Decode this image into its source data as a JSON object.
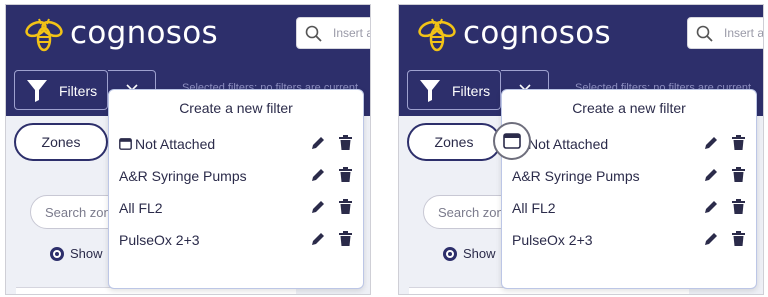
{
  "brand": {
    "name": "cognosos"
  },
  "search": {
    "placeholder": "Insert an"
  },
  "filter_bar": {
    "filters_label": "Filters",
    "selected_text": "Selected filters: no filters are current"
  },
  "zones_label": "Zones",
  "search_zone_placeholder": "Search zon",
  "show_label": "Show",
  "dropdown": {
    "title": "Create a new filter",
    "items": [
      {
        "label": "Not Attached",
        "icon": "calendar-icon"
      },
      {
        "label": "A&R Syringe Pumps"
      },
      {
        "label": "All FL2"
      },
      {
        "label": "PulseOx 2+3"
      }
    ]
  },
  "colors": {
    "navy": "#2d2f6b",
    "background": "#eef0f6",
    "dropdown_border": "#bcc6e6",
    "logo_yellow": "#f2c316"
  }
}
